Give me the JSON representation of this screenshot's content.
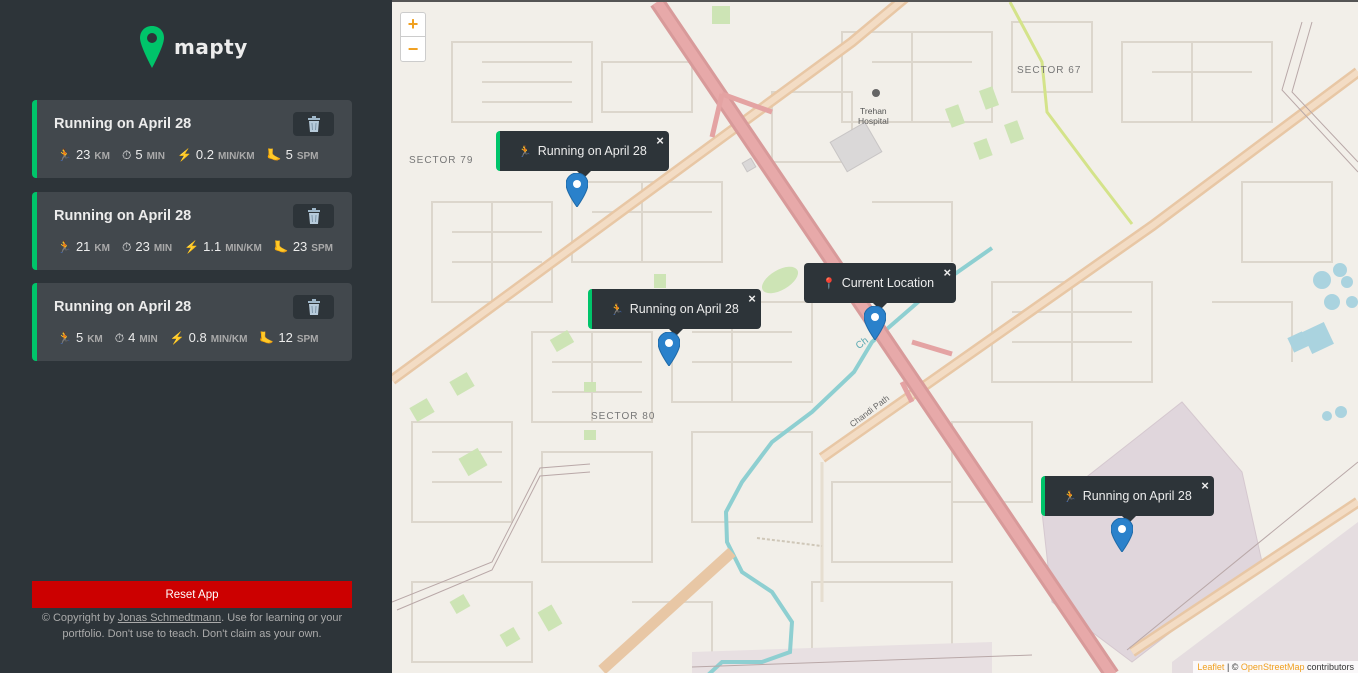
{
  "app": {
    "logo_text": "mapty",
    "accent_color": "#00c46a",
    "logo_icon": "map-pin-icon"
  },
  "workouts": [
    {
      "title": "Running on April 28",
      "delete_icon": "trash-icon",
      "details": [
        {
          "icon": "🏃",
          "icon_name": "runner-icon",
          "value": "23",
          "unit": "km"
        },
        {
          "icon": "⏱",
          "icon_name": "stopwatch-icon",
          "value": "5",
          "unit": "min"
        },
        {
          "icon": "⚡",
          "icon_name": "lightning-icon",
          "value": "0.2",
          "unit": "min/km"
        },
        {
          "icon": "🦶",
          "icon_name": "foot-icon",
          "value": "5",
          "unit": "spm"
        }
      ]
    },
    {
      "title": "Running on April 28",
      "delete_icon": "trash-icon",
      "details": [
        {
          "icon": "🏃",
          "icon_name": "runner-icon",
          "value": "21",
          "unit": "km"
        },
        {
          "icon": "⏱",
          "icon_name": "stopwatch-icon",
          "value": "23",
          "unit": "min"
        },
        {
          "icon": "⚡",
          "icon_name": "lightning-icon",
          "value": "1.1",
          "unit": "min/km"
        },
        {
          "icon": "🦶",
          "icon_name": "foot-icon",
          "value": "23",
          "unit": "spm"
        }
      ]
    },
    {
      "title": "Running on April 28",
      "delete_icon": "trash-icon",
      "details": [
        {
          "icon": "🏃",
          "icon_name": "runner-icon",
          "value": "5",
          "unit": "km"
        },
        {
          "icon": "⏱",
          "icon_name": "stopwatch-icon",
          "value": "4",
          "unit": "min"
        },
        {
          "icon": "⚡",
          "icon_name": "lightning-icon",
          "value": "0.8",
          "unit": "min/km"
        },
        {
          "icon": "🦶",
          "icon_name": "foot-icon",
          "value": "12",
          "unit": "spm"
        }
      ]
    }
  ],
  "reset_button": "Reset App",
  "copyright": {
    "prefix": "© Copyright by ",
    "author": "Jonas Schmedtmann",
    "suffix": ". Use for learning or your portfolio. Don't use to teach. Don't claim as your own."
  },
  "map": {
    "zoom_in": "+",
    "zoom_out": "−",
    "labels": {
      "sector_67": "SECTOR 67",
      "sector_79": "SECTOR 79",
      "sector_80": "SECTOR 80",
      "hospital_line1": "Trehan",
      "hospital_line2": "Hospital",
      "road_chandi": "Chandi Path",
      "road_ch": "Ch"
    },
    "popups": [
      {
        "text": "Running on April 28",
        "icon": "🏃",
        "type": "running",
        "close": "×"
      },
      {
        "text": "Running on April 28",
        "icon": "🏃",
        "type": "running",
        "close": "×"
      },
      {
        "text": "Current Location",
        "icon": "📍",
        "type": "location",
        "close": "×"
      },
      {
        "text": "Running on April 28",
        "icon": "🏃",
        "type": "running",
        "close": "×"
      }
    ],
    "attribution": {
      "leaflet": "Leaflet",
      "separator": " | © ",
      "osm": "OpenStreetMap",
      "contributors": " contributors"
    }
  }
}
